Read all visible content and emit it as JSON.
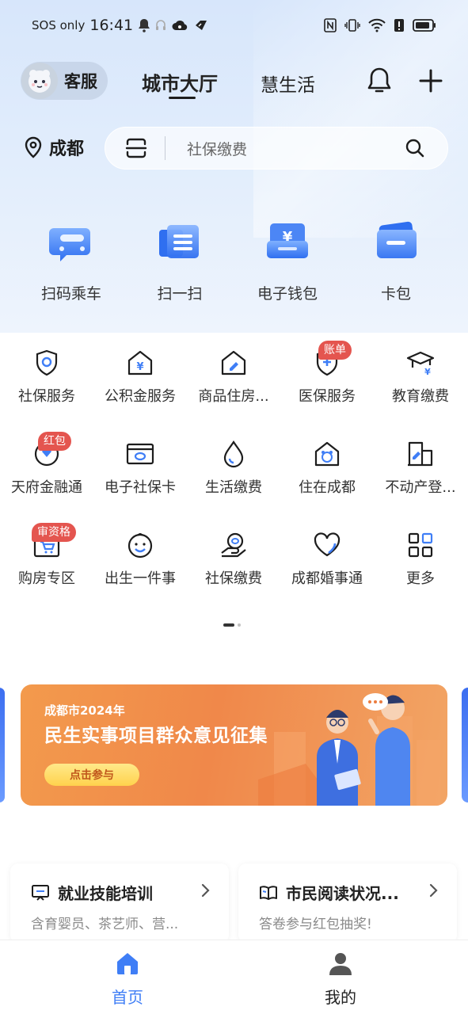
{
  "status_bar": {
    "carrier": "SOS only",
    "time": "16:41"
  },
  "top_nav": {
    "service_label": "客服",
    "tabs": [
      {
        "label": "城市大厅",
        "active": true
      },
      {
        "label": "慧生活",
        "active": false
      }
    ]
  },
  "location": {
    "city": "成都"
  },
  "search": {
    "text": "社保缴费"
  },
  "quick_actions": [
    {
      "label": "扫码乘车",
      "icon": "bus-code-icon"
    },
    {
      "label": "扫一扫",
      "icon": "scan-card-icon"
    },
    {
      "label": "电子钱包",
      "icon": "wallet-icon"
    },
    {
      "label": "卡包",
      "icon": "card-holder-icon"
    }
  ],
  "services": [
    {
      "label": "社保服务",
      "icon": "shield-icon",
      "badge": ""
    },
    {
      "label": "公积金服务",
      "icon": "house-yuan-icon",
      "badge": ""
    },
    {
      "label": "商品住房...",
      "icon": "house-edit-icon",
      "badge": ""
    },
    {
      "label": "医保服务",
      "icon": "medical-shield-icon",
      "badge": "账单"
    },
    {
      "label": "教育缴费",
      "icon": "graduation-cap-icon",
      "badge": ""
    },
    {
      "label": "天府金融通",
      "icon": "diamond-circle-icon",
      "badge": "红包"
    },
    {
      "label": "电子社保卡",
      "icon": "social-card-icon",
      "badge": ""
    },
    {
      "label": "生活缴费",
      "icon": "water-drop-icon",
      "badge": ""
    },
    {
      "label": "住在成都",
      "icon": "panda-house-icon",
      "badge": ""
    },
    {
      "label": "不动产登...",
      "icon": "building-edit-icon",
      "badge": ""
    },
    {
      "label": "购房专区",
      "icon": "shopping-cart-icon",
      "badge": "审资格"
    },
    {
      "label": "出生一件事",
      "icon": "baby-face-icon",
      "badge": ""
    },
    {
      "label": "社保缴费",
      "icon": "hand-coin-icon",
      "badge": ""
    },
    {
      "label": "成都婚事通",
      "icon": "heart-icon",
      "badge": ""
    },
    {
      "label": "更多",
      "icon": "grid-more-icon",
      "badge": ""
    }
  ],
  "banner": {
    "subtitle": "成都市2024年",
    "title": "民生实事项目群众意见征集",
    "button": "点击参与"
  },
  "cards": [
    {
      "title": "就业技能培训",
      "subtitle": "含育婴员、茶艺师、营...",
      "icon": "training-board-icon"
    },
    {
      "title": "市民阅读状况...",
      "subtitle": "答卷参与红包抽奖!",
      "icon": "open-book-icon"
    }
  ],
  "bottom_nav": [
    {
      "label": "首页",
      "active": true
    },
    {
      "label": "我的",
      "active": false
    }
  ],
  "colors": {
    "accent": "#3f7ef6",
    "badge": "#e4554f",
    "banner": "#f0884a"
  }
}
